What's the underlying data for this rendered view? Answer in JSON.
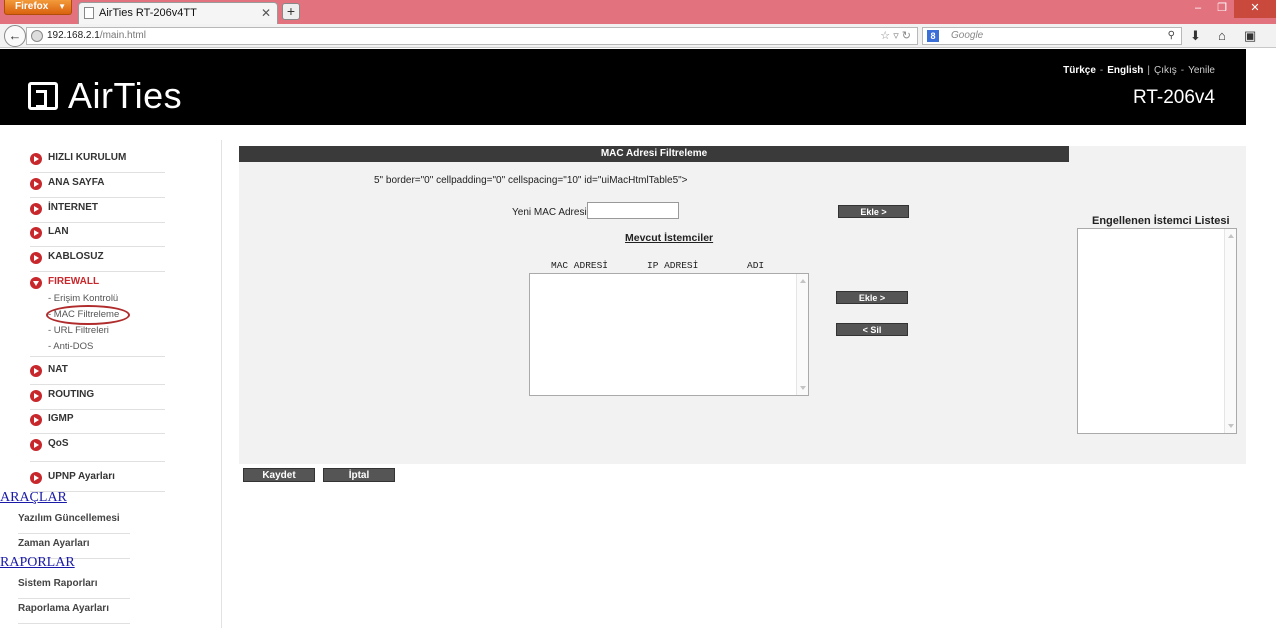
{
  "browser": {
    "firefox_label": "Firefox",
    "tab_title": "AirTies RT-206v4TT",
    "url_host": "192.168.2.1",
    "url_path": "/main.html",
    "search_placeholder": "Google"
  },
  "header": {
    "logo_text": "AirTies",
    "lang_turkish": "Türkçe",
    "lang_english": "English",
    "exit_label": "Çıkış",
    "refresh_label": "Yenile",
    "model": "RT-206v4"
  },
  "sidebar": {
    "items": [
      {
        "label": "HIZLI KURULUM"
      },
      {
        "label": "ANA SAYFA"
      },
      {
        "label": "İNTERNET"
      },
      {
        "label": "LAN"
      },
      {
        "label": "KABLOSUZ"
      },
      {
        "label": "FIREWALL"
      },
      {
        "label": "NAT"
      },
      {
        "label": "ROUTING"
      },
      {
        "label": "IGMP"
      },
      {
        "label": "QoS"
      },
      {
        "label": "UPNP Ayarları"
      }
    ],
    "firewall_sub": [
      {
        "label": "- Erişim Kontrolü"
      },
      {
        "label": "- MAC Filtreleme"
      },
      {
        "label": "- URL Filtreleri"
      },
      {
        "label": "- Anti-DOS"
      }
    ],
    "tools_heading": "ARAÇLAR",
    "tools": [
      {
        "label": "Yazılım Güncellemesi"
      },
      {
        "label": "Zaman Ayarları"
      }
    ],
    "reports_heading": "RAPORLAR",
    "reports": [
      {
        "label": "Sistem Raporları"
      },
      {
        "label": "Raporlama Ayarları"
      }
    ]
  },
  "main": {
    "title": "MAC Adresi Filtreleme",
    "stray_text": "5\" border=\"0\" cellpadding=\"0\" cellspacing=\"10\" id=\"uiMacHtmlTable5\">",
    "new_mac_label": "Yeni MAC Adresi",
    "new_mac_value": "",
    "add_button_1": "Ekle >",
    "current_clients_title": "Mevcut İstemciler",
    "col_mac": "MAC ADRESİ",
    "col_ip": "IP ADRESİ",
    "col_name": "ADI",
    "add_button_2": "Ekle >",
    "delete_button": "< Sil",
    "blocked_title": "Engellenen İstemci Listesi",
    "save_button": "Kaydet",
    "cancel_button": "İptal"
  },
  "colors": {
    "accent_red": "#c8282c",
    "header_bg": "#000000",
    "panel_bg": "#f2f2f2",
    "title_bar": "#3a3a3a"
  }
}
